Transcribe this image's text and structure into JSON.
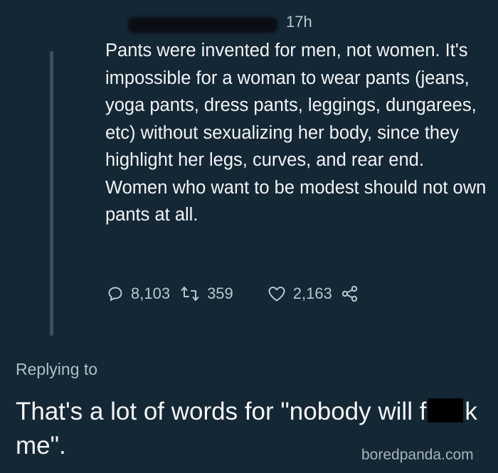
{
  "tweet": {
    "time": "17h",
    "text": "Pants were invented for men, not women. It's impossible for a woman to wear pants (jeans, yoga pants, dress pants, leggings, dungarees, etc) without sexualizing her body, since they highlight her legs, curves, and rear end. Women who want to be modest should not own pants at all.",
    "replies": "8,103",
    "retweets": "359",
    "likes": "2,163"
  },
  "reply": {
    "replying_to": "Replying to",
    "text_before": "That's a lot of words for \"nobody will f",
    "text_after": "k me\"."
  },
  "watermark": "boredpanda.com",
  "colors": {
    "background": "#142735",
    "text": "#f1f4f6",
    "muted": "#b8c6cf"
  },
  "icons": [
    "reply-icon",
    "retweet-icon",
    "like-icon",
    "share-icon"
  ]
}
